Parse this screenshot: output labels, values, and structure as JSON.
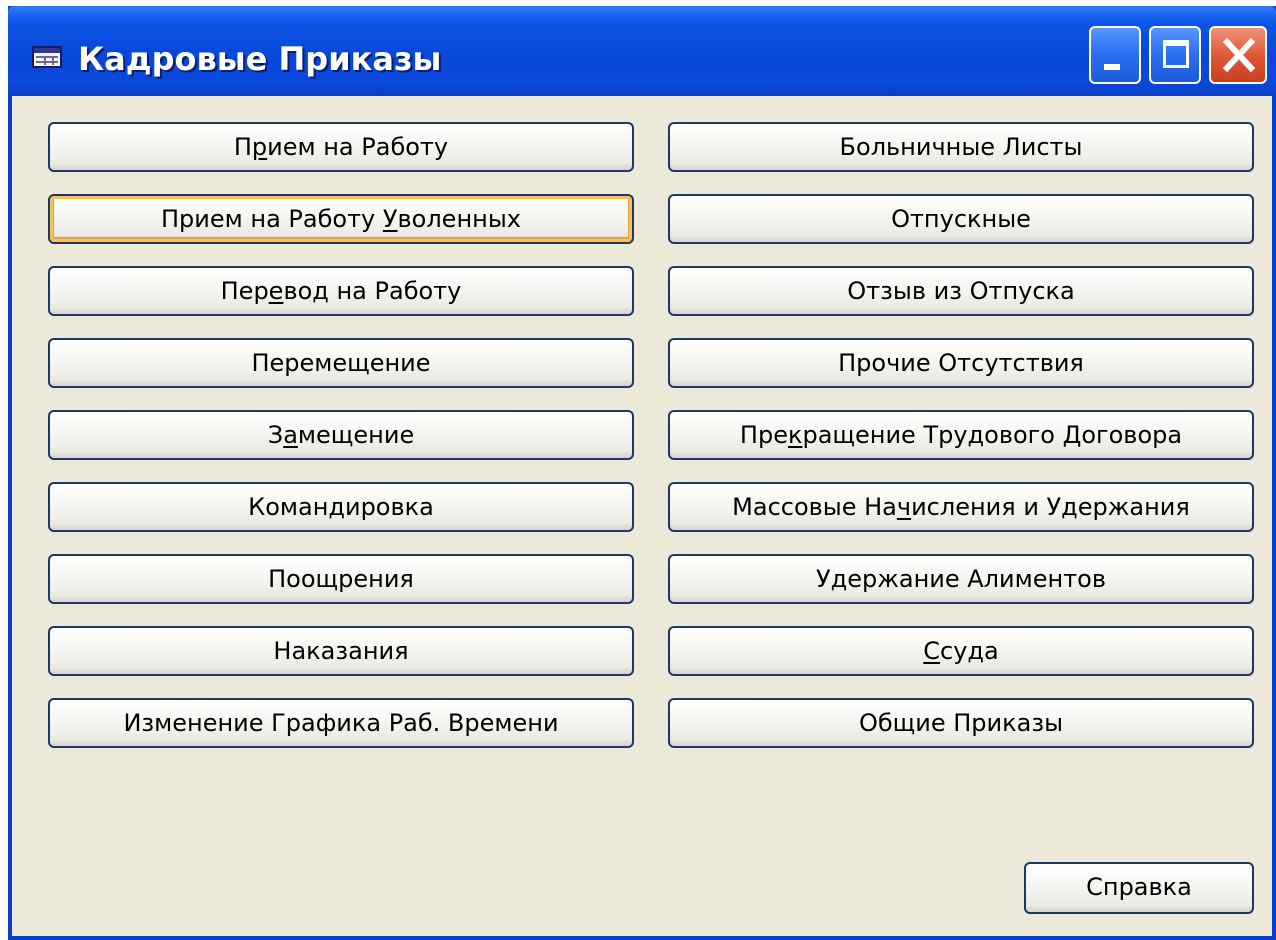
{
  "window": {
    "title": "Кадровые Приказы",
    "icon": "table-icon",
    "controls": {
      "minimize": "minimize-icon",
      "maximize": "maximize-icon",
      "close": "close-icon"
    }
  },
  "buttons": {
    "left": [
      {
        "id": "hire",
        "before": "П",
        "accel": "р",
        "after": "ием на Работу",
        "state": "focused"
      },
      {
        "id": "rehire-dismissed",
        "before": "Прием на Работу ",
        "accel": "У",
        "after": "воленных",
        "state": "hot"
      },
      {
        "id": "transfer",
        "before": "Пер",
        "accel": "е",
        "after": "вод на Работу",
        "state": "normal"
      },
      {
        "id": "relocation",
        "before": "Перемещение",
        "accel": "",
        "after": "",
        "state": "normal"
      },
      {
        "id": "substitution",
        "before": "З",
        "accel": "а",
        "after": "мещение",
        "state": "normal"
      },
      {
        "id": "business-trip",
        "before": "Командировка",
        "accel": "",
        "after": "",
        "state": "normal"
      },
      {
        "id": "rewards",
        "before": "Поощрения",
        "accel": "",
        "after": "",
        "state": "normal"
      },
      {
        "id": "penalties",
        "before": "Наказания",
        "accel": "",
        "after": "",
        "state": "normal"
      },
      {
        "id": "schedule-change",
        "before": "Изменение Графика Раб. Времени",
        "accel": "",
        "after": "",
        "state": "normal"
      }
    ],
    "right": [
      {
        "id": "sick-leave",
        "before": "Больничные Листы",
        "accel": "",
        "after": "",
        "state": "normal"
      },
      {
        "id": "vacation",
        "before": "Отпускные",
        "accel": "",
        "after": "",
        "state": "normal"
      },
      {
        "id": "vacation-recall",
        "before": "Отзыв из Отпуска",
        "accel": "",
        "after": "",
        "state": "normal"
      },
      {
        "id": "other-absences",
        "before": "Прочие Отсутствия",
        "accel": "",
        "after": "",
        "state": "normal"
      },
      {
        "id": "contract-termination",
        "before": "Пре",
        "accel": "к",
        "after": "ращение Трудового Договора",
        "state": "normal"
      },
      {
        "id": "mass-accruals",
        "before": "Массовые На",
        "accel": "ч",
        "after": "исления и Удержания",
        "state": "normal"
      },
      {
        "id": "alimony",
        "before": "Удержание Алиментов",
        "accel": "",
        "after": "",
        "state": "normal"
      },
      {
        "id": "loan",
        "before": "",
        "accel": "С",
        "after": "суда",
        "state": "normal"
      },
      {
        "id": "general-orders",
        "before": "Общие Приказы",
        "accel": "",
        "after": "",
        "state": "normal"
      }
    ]
  },
  "help_button": {
    "label": "Справка"
  },
  "colors": {
    "titlebar": "#0847d8",
    "client_bg": "#ece9d8",
    "button_border": "#1d3769",
    "hot_highlight": "#f5c25a",
    "close_button": "#e0593a"
  }
}
